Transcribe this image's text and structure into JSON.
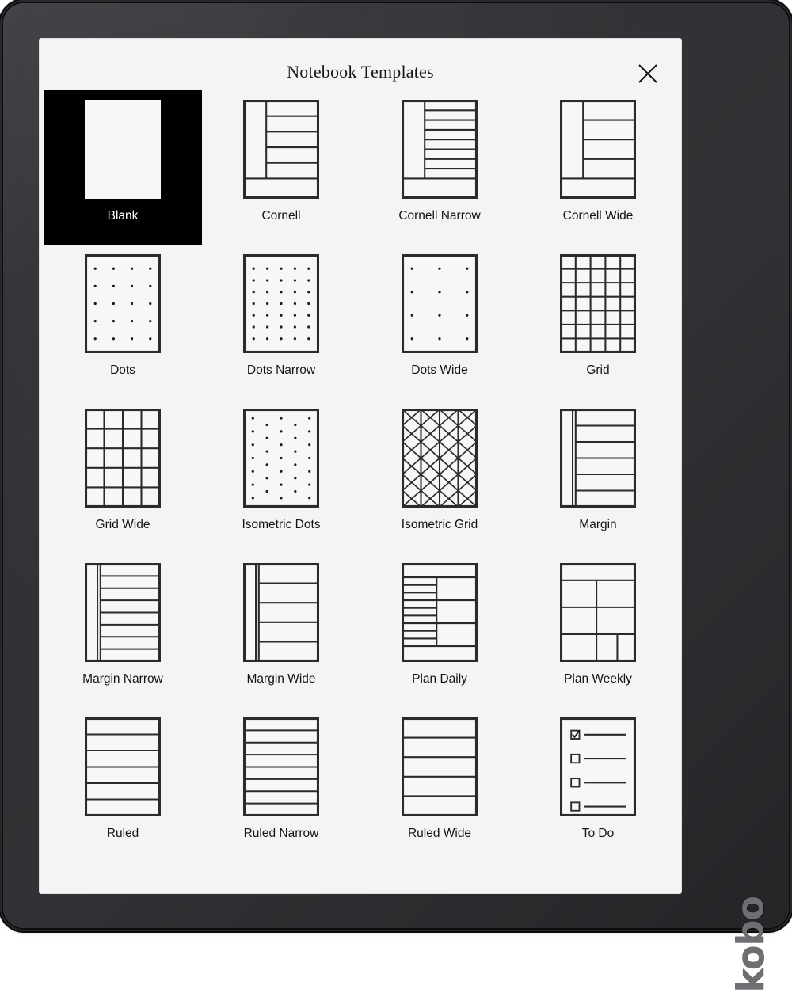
{
  "device": {
    "brand": "kobo"
  },
  "dialog": {
    "title": "Notebook Templates",
    "close_icon": "close-icon",
    "close_label": "Close"
  },
  "templates": [
    {
      "id": "blank",
      "label": "Blank",
      "selected": true,
      "pattern": "blank"
    },
    {
      "id": "cornell",
      "label": "Cornell",
      "selected": false,
      "pattern": "cornell",
      "lines": 4
    },
    {
      "id": "cornell-narrow",
      "label": "Cornell Narrow",
      "selected": false,
      "pattern": "cornell",
      "lines": 7
    },
    {
      "id": "cornell-wide",
      "label": "Cornell Wide",
      "selected": false,
      "pattern": "cornell",
      "lines": 3
    },
    {
      "id": "dots",
      "label": "Dots",
      "selected": false,
      "pattern": "dots",
      "cols": 4,
      "rows": 5
    },
    {
      "id": "dots-narrow",
      "label": "Dots Narrow",
      "selected": false,
      "pattern": "dots",
      "cols": 5,
      "rows": 7
    },
    {
      "id": "dots-wide",
      "label": "Dots Wide",
      "selected": false,
      "pattern": "dots",
      "cols": 3,
      "rows": 4
    },
    {
      "id": "grid",
      "label": "Grid",
      "selected": false,
      "pattern": "grid",
      "cols": 5,
      "rows": 7
    },
    {
      "id": "grid-wide",
      "label": "Grid Wide",
      "selected": false,
      "pattern": "grid",
      "cols": 4,
      "rows": 5
    },
    {
      "id": "isometric-dots",
      "label": "Isometric Dots",
      "selected": false,
      "pattern": "isodots",
      "cols": 3,
      "rows": 7
    },
    {
      "id": "isometric-grid",
      "label": "Isometric Grid",
      "selected": false,
      "pattern": "isogrid",
      "cols": 4,
      "rows": 6
    },
    {
      "id": "margin",
      "label": "Margin",
      "selected": false,
      "pattern": "margin",
      "lines": 5
    },
    {
      "id": "margin-narrow",
      "label": "Margin Narrow",
      "selected": false,
      "pattern": "margin",
      "lines": 7
    },
    {
      "id": "margin-wide",
      "label": "Margin Wide",
      "selected": false,
      "pattern": "margin",
      "lines": 4
    },
    {
      "id": "plan-daily",
      "label": "Plan Daily",
      "selected": false,
      "pattern": "plan-daily"
    },
    {
      "id": "plan-weekly",
      "label": "Plan Weekly",
      "selected": false,
      "pattern": "plan-weekly"
    },
    {
      "id": "ruled",
      "label": "Ruled",
      "selected": false,
      "pattern": "ruled",
      "lines": 5
    },
    {
      "id": "ruled-narrow",
      "label": "Ruled Narrow",
      "selected": false,
      "pattern": "ruled",
      "lines": 7
    },
    {
      "id": "ruled-wide",
      "label": "Ruled Wide",
      "selected": false,
      "pattern": "ruled",
      "lines": 4
    },
    {
      "id": "todo",
      "label": "To Do",
      "selected": false,
      "pattern": "todo",
      "items": 4,
      "checked": 1
    }
  ],
  "colors": {
    "screen_background": "#f4f4f4",
    "thumb_background": "#f7f7f7",
    "ink": "#2b2b2b",
    "selected_background": "#000000",
    "selected_text": "#ffffff",
    "bezel": "#2d2f32",
    "brand_text": "#6d6f72"
  }
}
